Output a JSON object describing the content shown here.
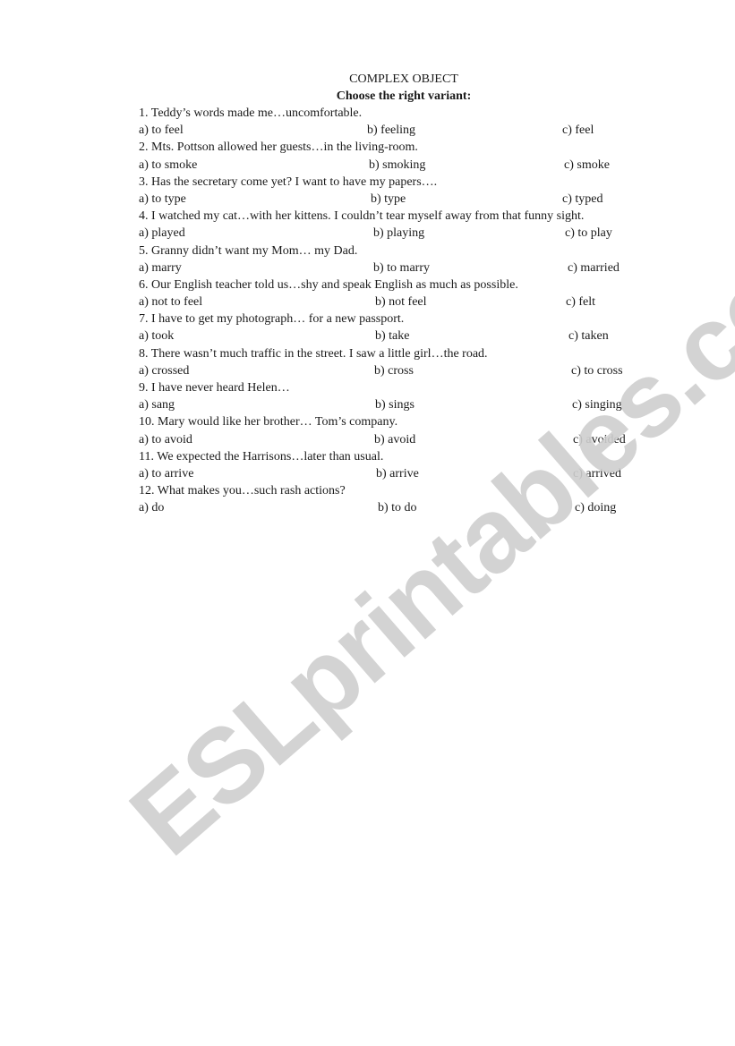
{
  "title": "COMPLEX OBJECT",
  "subtitle": "Choose the right variant:",
  "watermark": "ESLprintables.com",
  "questions": [
    {
      "text": "1.   Teddy’s words made me…uncomfortable.",
      "a": "a) to feel",
      "b": "b) feeling",
      "c": "c) feel"
    },
    {
      "text": "2. Mts. Pottson allowed her guests…in the living-room.",
      "a": "a) to smoke",
      "b": "b) smoking",
      "c": "c) smoke"
    },
    {
      "text": "3. Has the secretary come yet? I want to have my papers….",
      "a": "a) to type",
      "b": "b) type",
      "c": "c) typed"
    },
    {
      "text": "4. I watched my cat…with her kittens. I couldn’t tear myself away from that funny sight.",
      "a": "a) played",
      "b": "b) playing",
      "c": "c) to play"
    },
    {
      "text": "5. Granny didn’t want my Mom… my Dad.",
      "a": "a) marry",
      "b": "b) to marry",
      "c": "c) married"
    },
    {
      "text": "6. Our English teacher told us…shy and speak English as much as possible.",
      "a": "a) not to feel",
      "b": "b) not feel",
      "c": "c) felt"
    },
    {
      "text": "7. I have to get my photograph…  for a new passport.",
      "a": "a) took",
      "b": "b) take",
      "c": "c) taken"
    },
    {
      "text": "8. There wasn’t much traffic in the street. I saw a little girl…the road.",
      "a": "a) crossed",
      "b": "b) cross",
      "c": "c) to cross"
    },
    {
      "text": "9. I have never heard Helen…",
      "a": "a) sang",
      "b": "b) sings",
      "c": "c) singing"
    },
    {
      "text": "10. Mary would like her brother… Tom’s company.",
      "a": "a) to avoid",
      "b": "b) avoid",
      "c": "c) avoided"
    },
    {
      "text": "11. We expected the Harrisons…later than usual.",
      "a": "a) to arrive",
      "b": "b) arrive",
      "c": "c) arrived"
    },
    {
      "text": "12. What makes you…such rash actions?",
      "a": "a) do",
      "b": "b) to do",
      "c": "c) doing"
    }
  ]
}
